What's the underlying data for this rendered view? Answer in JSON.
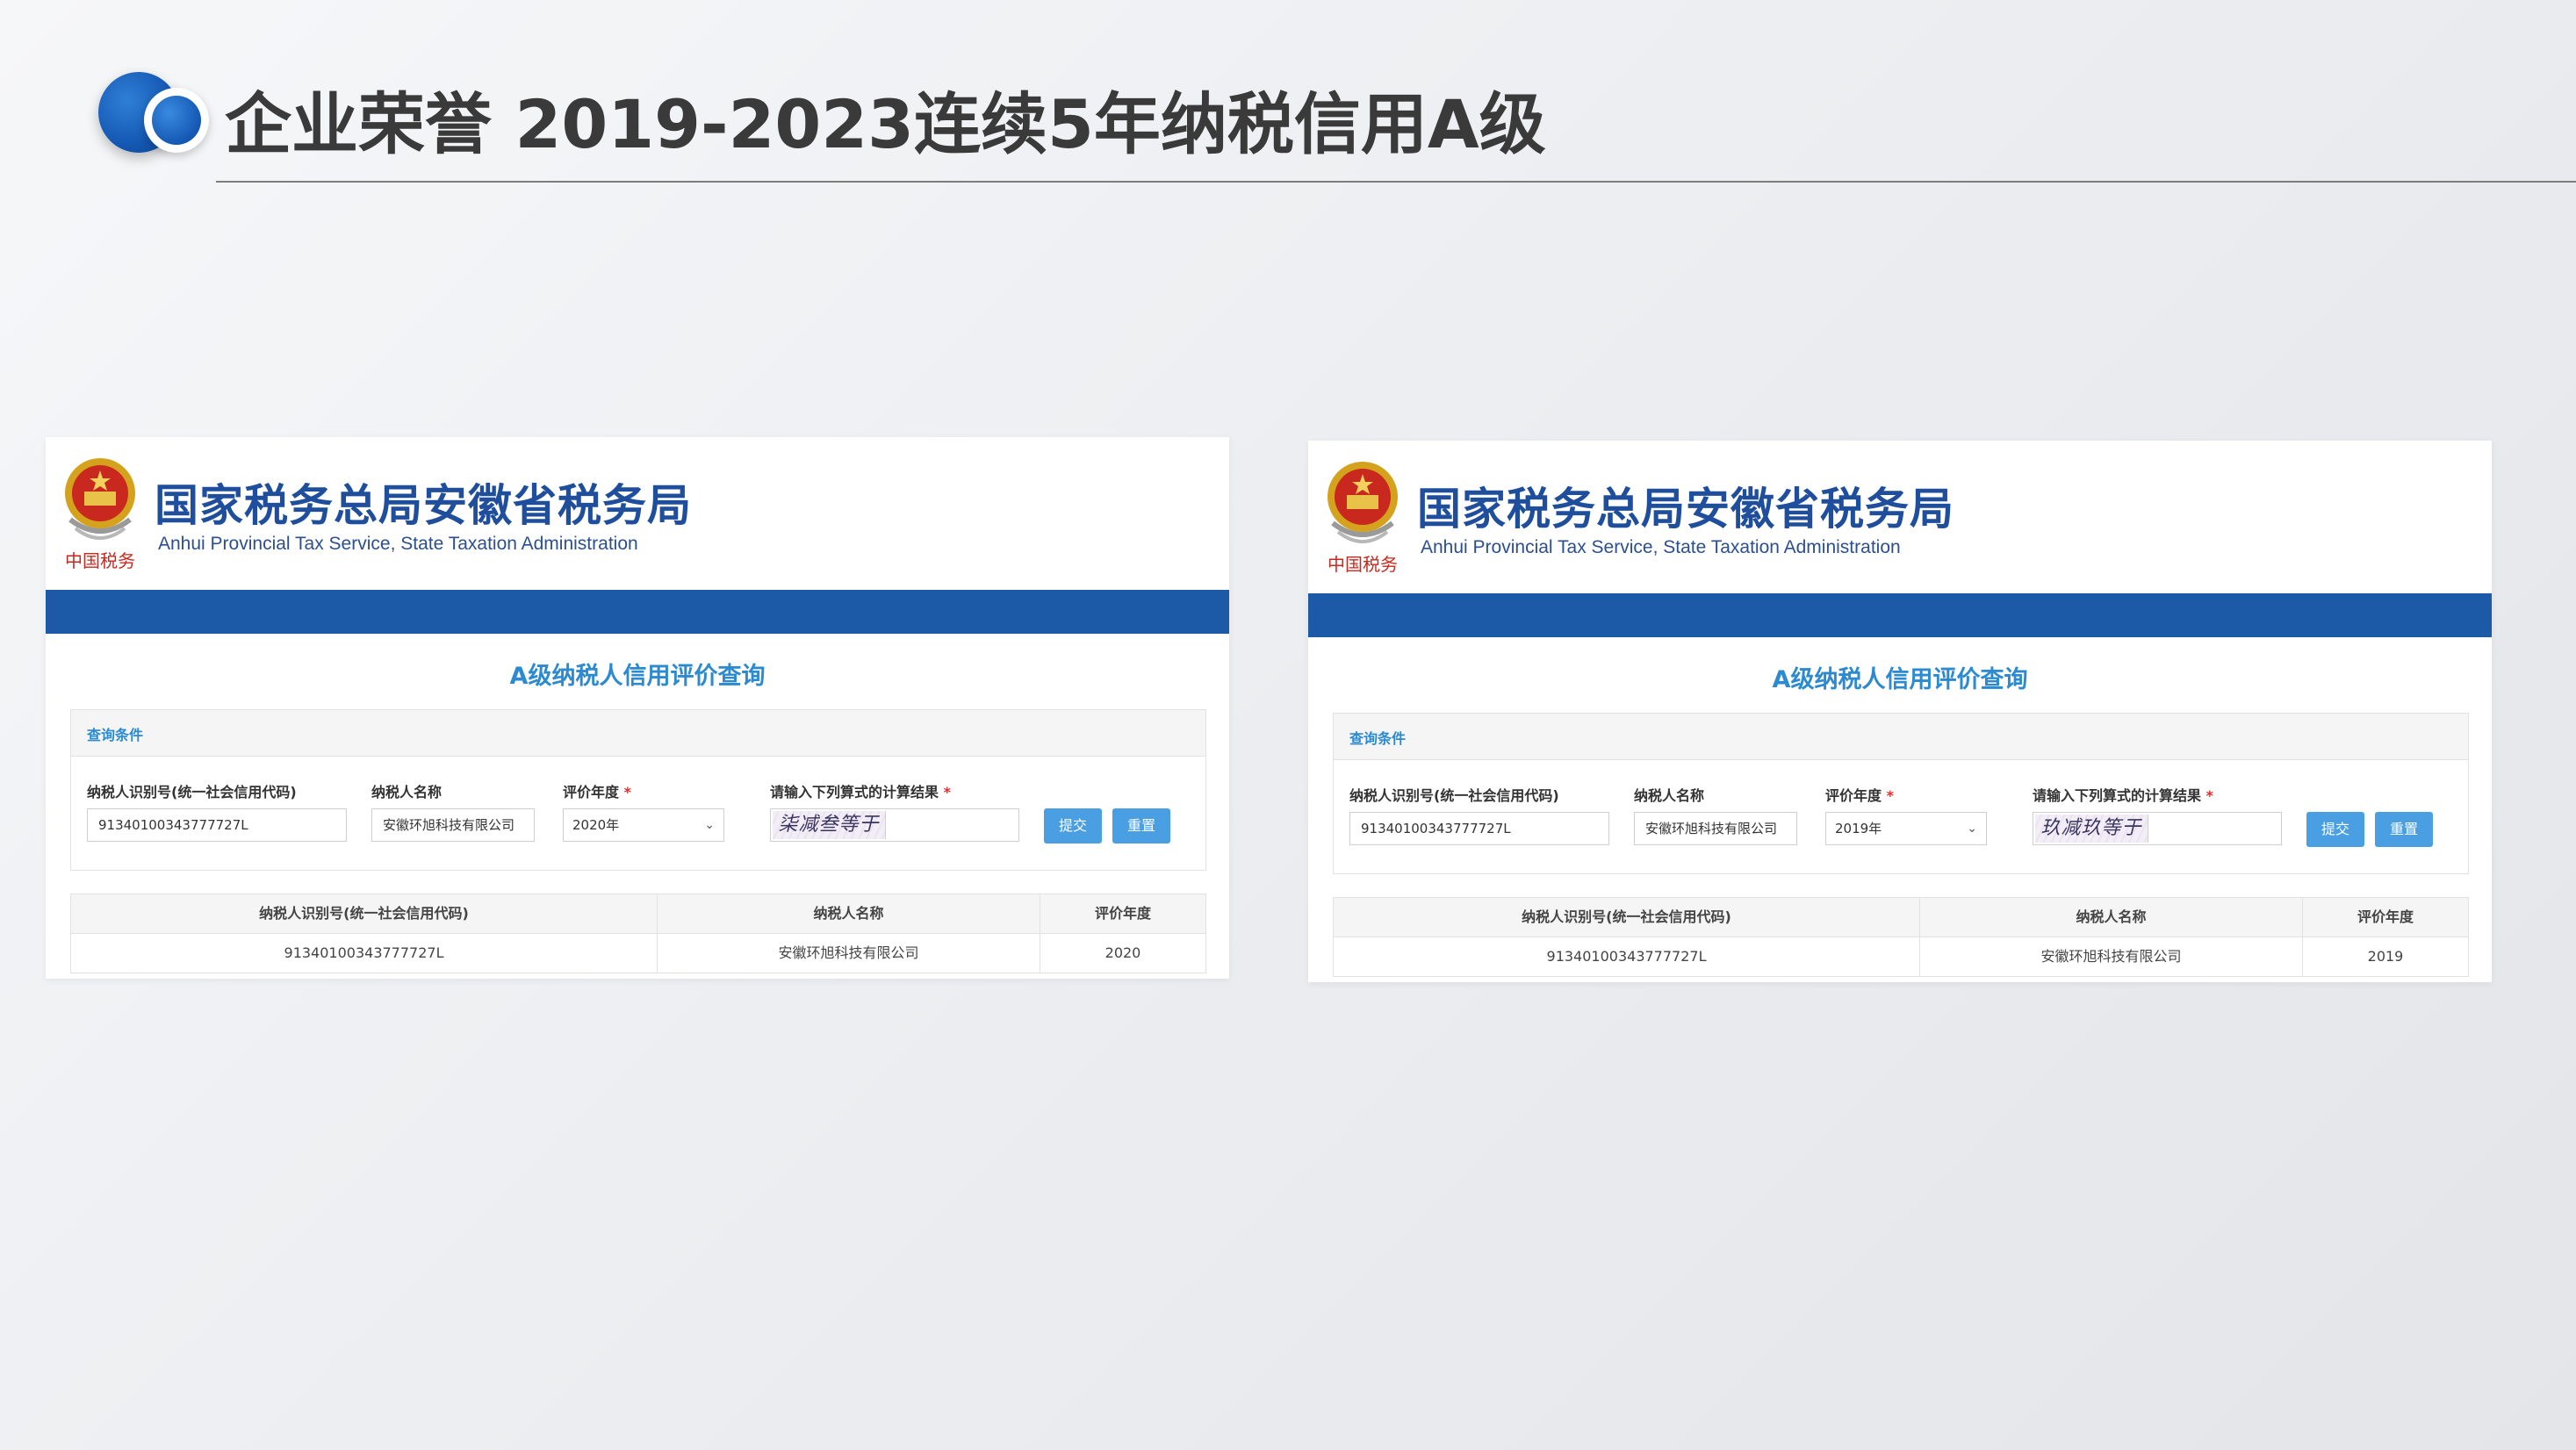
{
  "page": {
    "title": "企业荣誉 2019-2023连续5年纳税信用A级"
  },
  "panels": [
    {
      "header_cn": "国家税务总局安徽省税务局",
      "header_en": "Anhui Provincial Tax Service, State Taxation Administration",
      "emblem_text": "中国税务",
      "query_title": "A级纳税人信用评价查询",
      "conditions_label": "查询条件",
      "labels": {
        "tax_id": "纳税人识别号(统一社会信用代码)",
        "name": "纳税人名称",
        "year": "评价年度",
        "captcha": "请输入下列算式的计算结果",
        "required": "*"
      },
      "values": {
        "tax_id": "91340100343777727L",
        "name": "安徽环旭科技有限公司",
        "year": "2020年",
        "captcha_text": "柒减叁等于"
      },
      "buttons": {
        "submit": "提交",
        "reset": "重置"
      },
      "table": {
        "headers": [
          "纳税人识别号(统一社会信用代码)",
          "纳税人名称",
          "评价年度"
        ],
        "rows": [
          [
            "91340100343777727L",
            "安徽环旭科技有限公司",
            "2020"
          ]
        ]
      }
    },
    {
      "header_cn": "国家税务总局安徽省税务局",
      "header_en": "Anhui Provincial Tax Service, State Taxation Administration",
      "emblem_text": "中国税务",
      "query_title": "A级纳税人信用评价查询",
      "conditions_label": "查询条件",
      "labels": {
        "tax_id": "纳税人识别号(统一社会信用代码)",
        "name": "纳税人名称",
        "year": "评价年度",
        "captcha": "请输入下列算式的计算结果",
        "required": "*"
      },
      "values": {
        "tax_id": "91340100343777727L",
        "name": "安徽环旭科技有限公司",
        "year": "2019年",
        "captcha_text": "玖减玖等于"
      },
      "buttons": {
        "submit": "提交",
        "reset": "重置"
      },
      "table": {
        "headers": [
          "纳税人识别号(统一社会信用代码)",
          "纳税人名称",
          "评价年度"
        ],
        "rows": [
          [
            "91340100343777727L",
            "安徽环旭科技有限公司",
            "2019"
          ]
        ]
      }
    }
  ],
  "colors": {
    "brand_blue": "#1c5aa8",
    "accent_blue": "#2b8ad0",
    "button_blue": "#4a9fe2"
  },
  "icons": [
    "double-circle-logo-icon",
    "national-emblem-icon",
    "chevron-down-icon"
  ]
}
